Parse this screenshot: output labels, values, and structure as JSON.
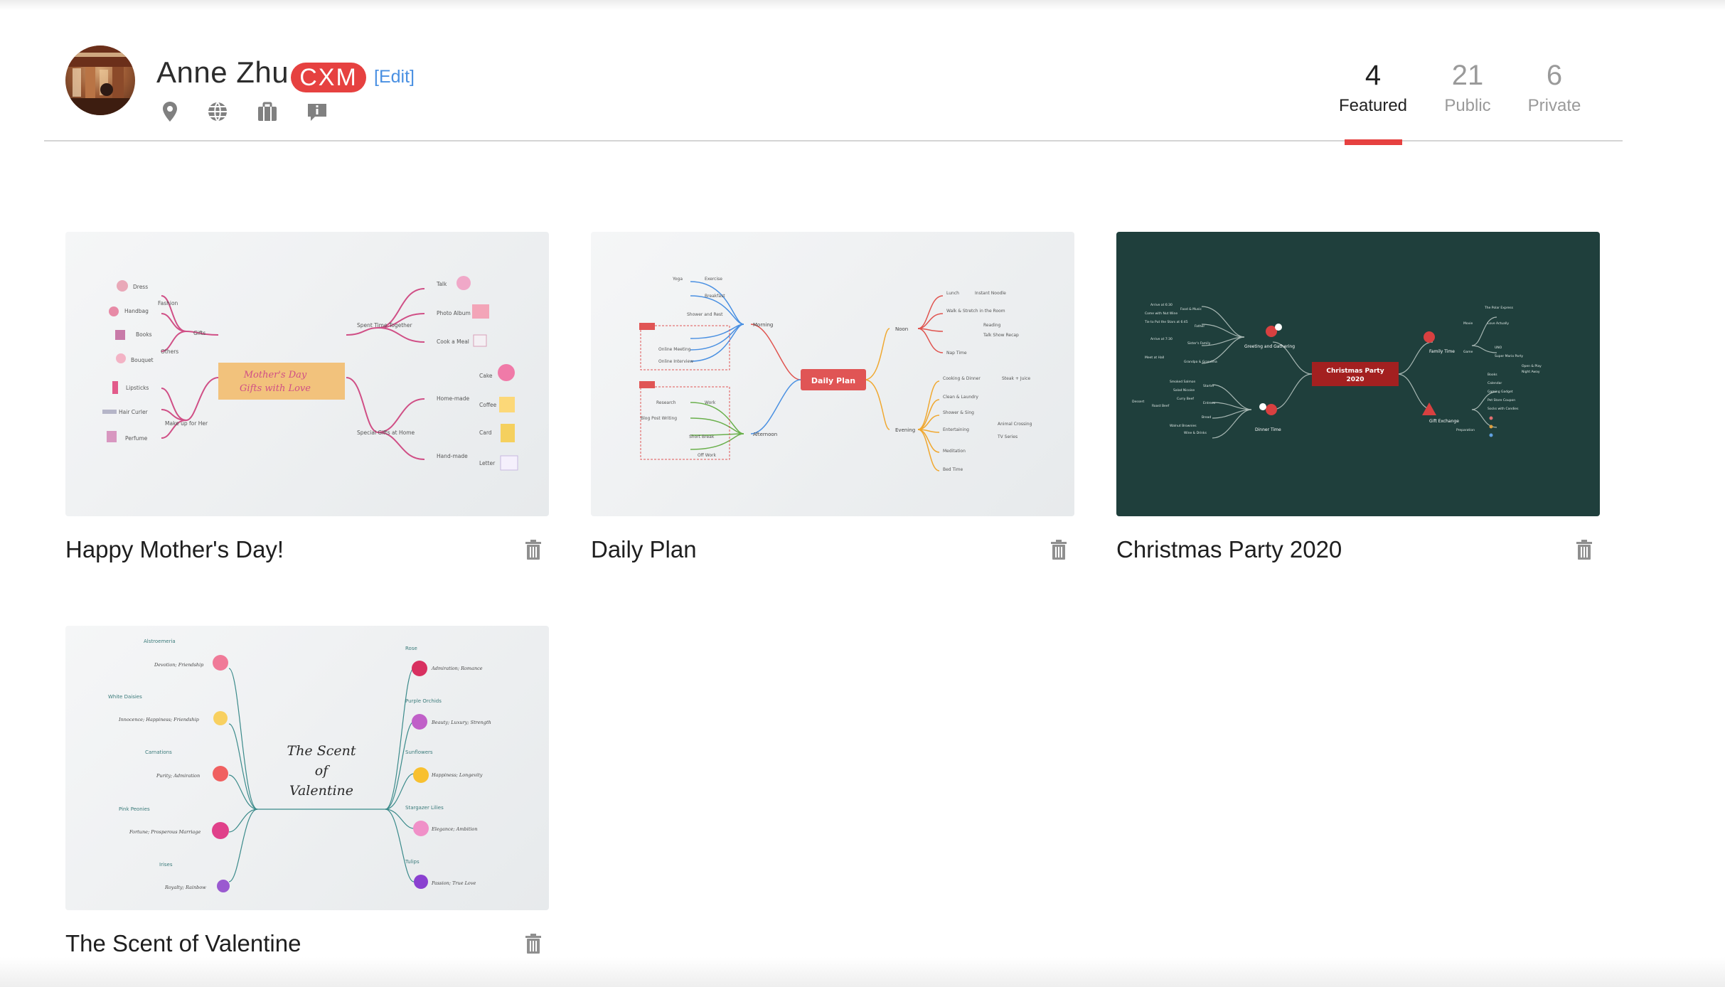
{
  "profile": {
    "name": "Anne Zhu",
    "badge": "CXM",
    "edit_label": "[Edit]"
  },
  "info_icons": [
    "location-pin-icon",
    "globe-icon",
    "briefcase-icon",
    "info-bubble-icon"
  ],
  "stats": [
    {
      "count": "4",
      "label": "Featured",
      "active": true
    },
    {
      "count": "21",
      "label": "Public",
      "active": false
    },
    {
      "count": "6",
      "label": "Private",
      "active": false
    }
  ],
  "maps": [
    {
      "title": "Happy Mother's Day!",
      "center": [
        "Mother's Day",
        "Gifts with Love"
      ],
      "left_branches": [
        "Gifts",
        "Make up for Her"
      ],
      "left_items": [
        "Dress",
        "Fashion",
        "Handbag",
        "Books",
        "Others",
        "Bouquet",
        "Lipsticks",
        "Hair Curler",
        "Perfume"
      ],
      "right_branches": [
        "Spent Time Together",
        "Special Gifts at Home"
      ],
      "right_items": [
        "Talk",
        "Photo Album",
        "Cook a Meal",
        "Home-made",
        "Cake",
        "Coffee",
        "Card",
        "Hand-made",
        "Letter"
      ]
    },
    {
      "title": "Daily Plan",
      "center": [
        "Daily Plan"
      ],
      "branches": [
        "Morning",
        "Afternoon",
        "Noon",
        "Evening"
      ],
      "morning_items": [
        "Yoga",
        "Exercise",
        "Breakfast",
        "Shower and Rest",
        "Online Meeting",
        "Online Interview"
      ],
      "afternoon_items": [
        "Research",
        "Work",
        "Blog Post Writing",
        "Short Break",
        "Off Work"
      ],
      "noon_items": [
        "Lunch",
        "Instant Noodle",
        "Walk & Stretch in the Room",
        "Reading",
        "Talk Show Recap",
        "Nap Time"
      ],
      "evening_items": [
        "Cooking & Dinner",
        "Steak + Juice",
        "Clean & Laundry",
        "Shower & Sing",
        "Entertaining",
        "Animal Crossing",
        "TV Series",
        "Meditation",
        "Bed Time"
      ]
    },
    {
      "title": "Christmas Party 2020",
      "center": [
        "Christmas Party",
        "2020"
      ],
      "branches": [
        "Greeting and Gathering",
        "Dinner Time",
        "Family Time",
        "Gift Exchange"
      ],
      "left_items": [
        "Arrive at 6:30",
        "Food & Music",
        "Come with Nut Wine",
        "Tie to Put the Stars at 6:45",
        "Father",
        "Arrive at 7:30",
        "Sister's Family",
        "Meet at Hall",
        "Grandpa & Grandma",
        "Smoked Salmon",
        "Salad Nicoise",
        "Starter",
        "Curry Beef",
        "Roast Beef",
        "Entrees",
        "Bread",
        "Walnut Brownies",
        "Dessert",
        "Wine & Drinks"
      ],
      "right_items": [
        "Movie",
        "The Polar Express",
        "Love Actually",
        "Game",
        "UNO",
        "Super Mario Party",
        "Open & Play",
        "Night Away",
        "Books",
        "Calendar",
        "Gaming Gadget",
        "Pet Store Coupon",
        "Socks with Candies",
        "Preparation"
      ]
    },
    {
      "title": "The Scent of Valentine",
      "center": [
        "The Scent",
        "of",
        "Valentine"
      ],
      "left_flowers": [
        {
          "name": "Alstroemeria",
          "meaning": "Devotion; Friendship"
        },
        {
          "name": "White Daisies",
          "meaning": "Innocence; Happiness; Friendship"
        },
        {
          "name": "Carnations",
          "meaning": "Purity; Admiration"
        },
        {
          "name": "Pink Peonies",
          "meaning": "Fortune; Prosperous Marriage"
        },
        {
          "name": "Irises",
          "meaning": "Royalty; Rainbow"
        }
      ],
      "right_flowers": [
        {
          "name": "Rose",
          "meaning": "Admiration; Romance"
        },
        {
          "name": "Purple Orchids",
          "meaning": "Beauty; Luxury; Strength"
        },
        {
          "name": "Sunflowers",
          "meaning": "Happiness; Longevity"
        },
        {
          "name": "Stargazer Lilies",
          "meaning": "Elegance; Ambition"
        },
        {
          "name": "Tulips",
          "meaning": "Passion; True Love"
        }
      ]
    }
  ],
  "colors": {
    "accent": "#e64140",
    "link": "#4a90e2",
    "christmas_bg": "#1f3f3c",
    "daily_center": "#e05555",
    "mothers_center": "#f2c27c"
  }
}
